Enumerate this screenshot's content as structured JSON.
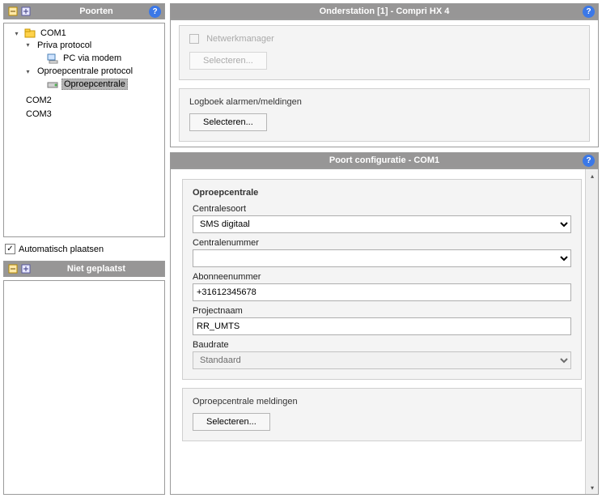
{
  "left": {
    "poorten_title": "Poorten",
    "niet_geplaatst_title": "Niet geplaatst",
    "auto_place_label": "Automatisch plaatsen",
    "auto_place_checked": true,
    "tree": {
      "com1": "COM1",
      "priva": "Priva protocol",
      "pc_modem": "PC via modem",
      "oproep_proto": "Oproepcentrale protocol",
      "oproep": "Oproepcentrale",
      "com2": "COM2",
      "com3": "COM3"
    }
  },
  "top": {
    "title": "Onderstation [1] - Compri HX 4",
    "netmgr_label": "Netwerkmanager",
    "select_btn": "Selecteren...",
    "logboek_title": "Logboek alarmen/meldingen"
  },
  "cfg": {
    "title": "Poort configuratie - COM1",
    "group_title": "Oproepcentrale",
    "centralesoort_label": "Centralesoort",
    "centralesoort_value": "SMS digitaal",
    "centralenummer_label": "Centralenummer",
    "centralenummer_value": "",
    "abonnee_label": "Abonneenummer",
    "abonnee_value": "+31612345678",
    "project_label": "Projectnaam",
    "project_value": "RR_UMTS",
    "baud_label": "Baudrate",
    "baud_value": "Standaard",
    "meld_title": "Oproepcentrale meldingen",
    "select_btn": "Selecteren..."
  }
}
